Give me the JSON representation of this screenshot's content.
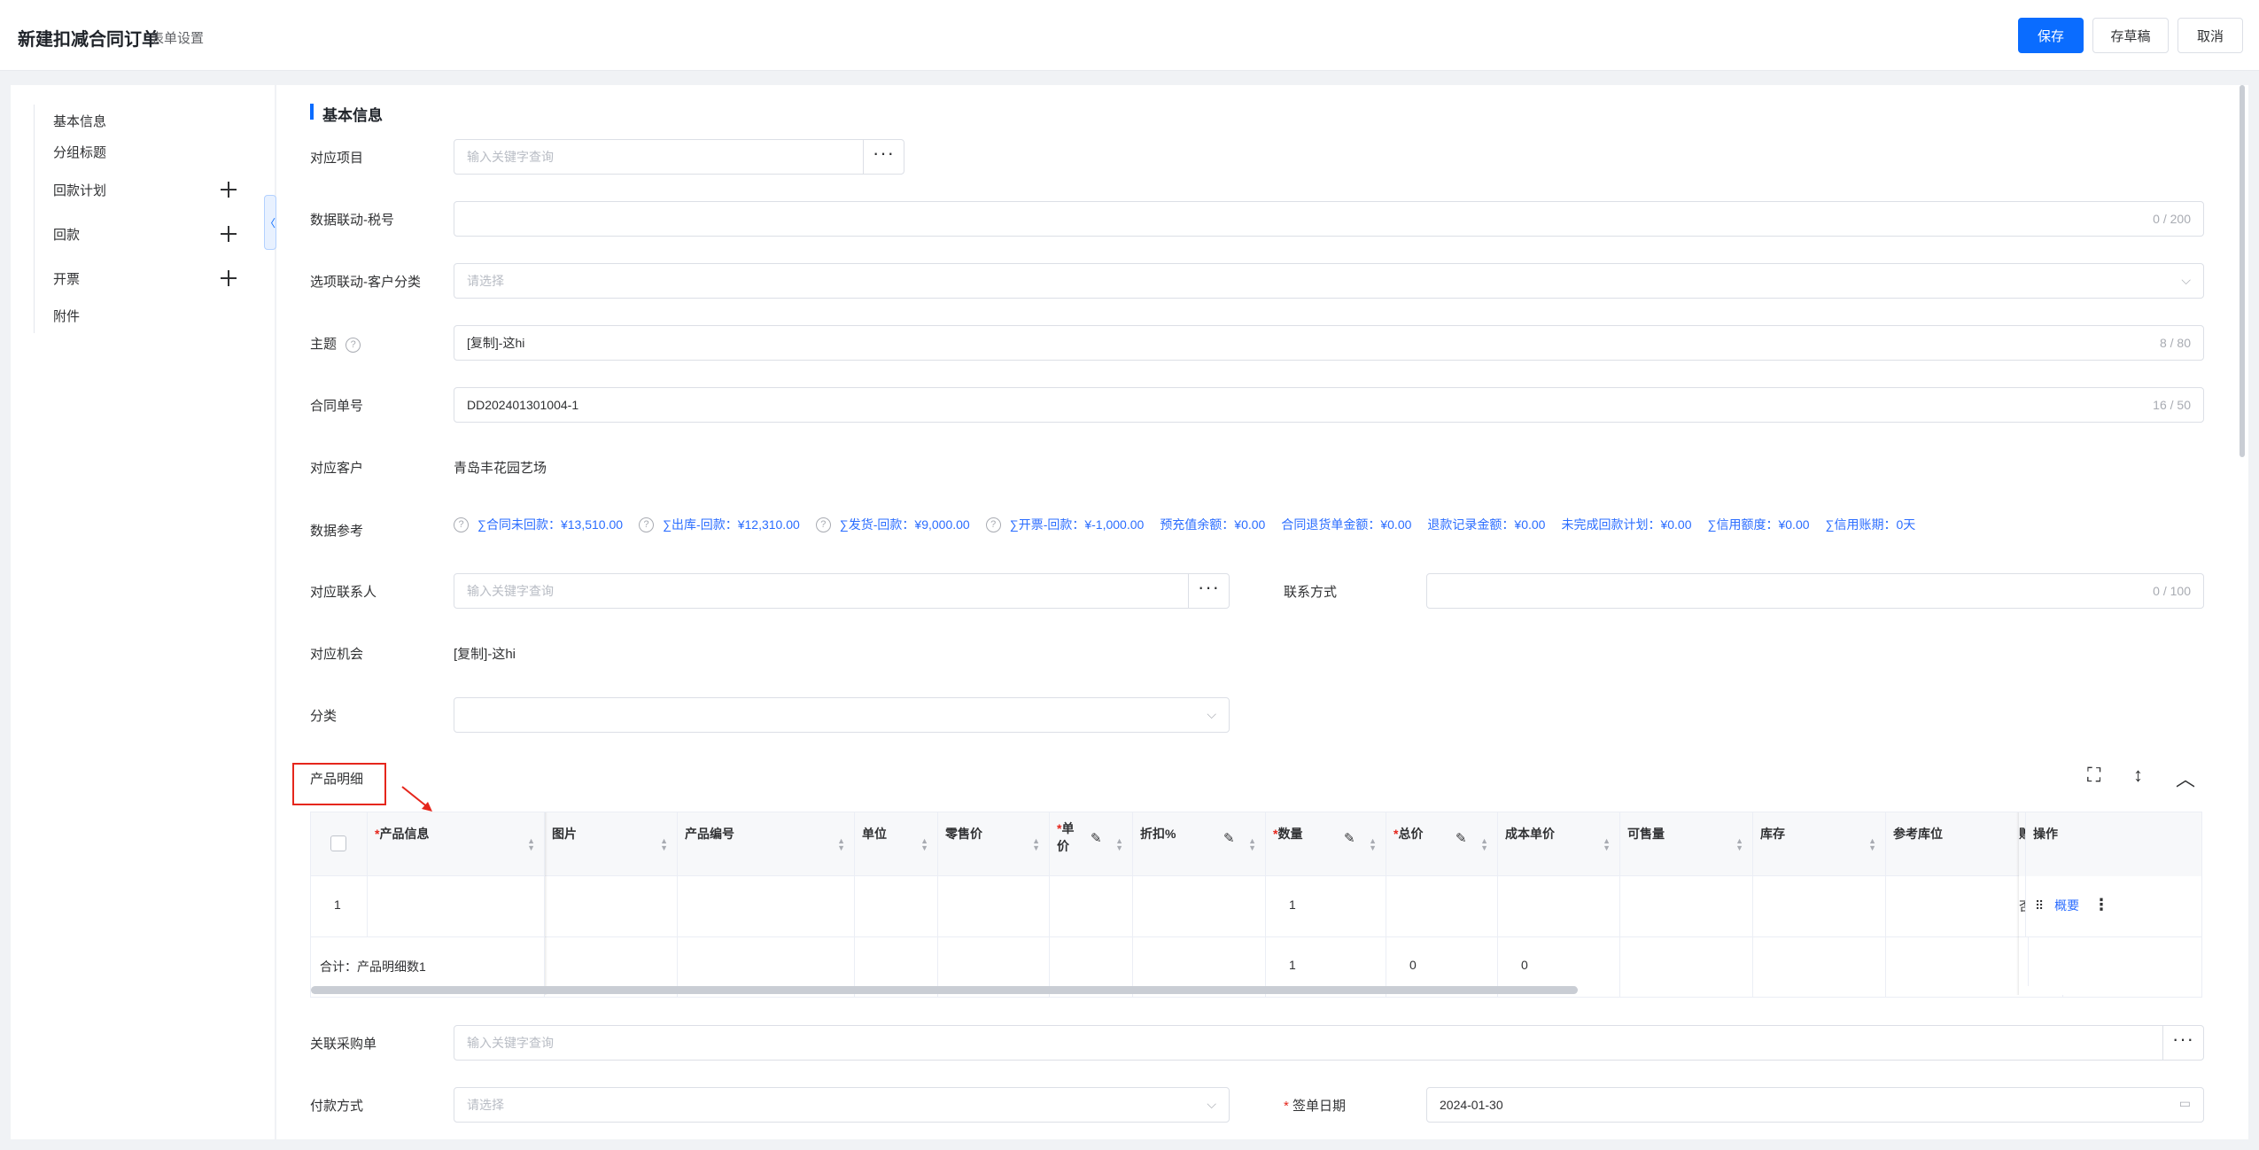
{
  "header": {
    "title": "新建扣减合同订单",
    "form_setting": "表单设置",
    "save": "保存",
    "draft": "存草稿",
    "cancel": "取消"
  },
  "sidebar": {
    "items": [
      "基本信息",
      "分组标题",
      "回款计划",
      "回款",
      "开票",
      "附件"
    ],
    "collapse_glyph": "〈"
  },
  "section": {
    "title": "基本信息"
  },
  "form": {
    "project": {
      "label": "对应项目",
      "placeholder": "输入关键字查询"
    },
    "tax": {
      "label": "数据联动-税号",
      "counter": "0 / 200"
    },
    "customer_type": {
      "label": "选项联动-客户分类",
      "placeholder": "请选择"
    },
    "subject": {
      "label": "主题",
      "value": "[复制]-这hi",
      "counter": "8 / 80"
    },
    "contract_no": {
      "label": "合同单号",
      "value": "DD202401301004-1",
      "counter": "16 / 50"
    },
    "customer": {
      "label": "对应客户",
      "value": "青岛丰花园艺场"
    },
    "data_ref": {
      "label": "数据参考"
    },
    "contact": {
      "label": "对应联系人",
      "placeholder": "输入关键字查询"
    },
    "contact_method": {
      "label": "联系方式",
      "counter": "0 / 100"
    },
    "opportunity": {
      "label": "对应机会",
      "value": "[复制]-这hi"
    },
    "category": {
      "label": "分类"
    },
    "purchase": {
      "label": "关联采购单",
      "placeholder": "输入关键字查询"
    },
    "payment": {
      "label": "付款方式",
      "placeholder": "请选择"
    },
    "sign_date": {
      "label": "签单日期",
      "required_mark": "*",
      "value": "2024-01-30"
    }
  },
  "refs": [
    "∑合同未回款：¥13,510.00",
    "∑出库-回款：¥12,310.00",
    "∑发货-回款：¥9,000.00",
    "∑开票-回款：¥-1,000.00",
    "预充值余额：¥0.00",
    "合同退货单金额：¥0.00",
    "退款记录金额：¥0.00",
    "未完成回款计划：¥0.00",
    "∑信用额度：¥0.00",
    "∑信用账期：0天"
  ],
  "help_glyph": "?",
  "dots_glyph": "···",
  "chevron_glyph": "⌵",
  "calendar_glyph": "▭",
  "product": {
    "title": "产品明细",
    "tools": [
      "⛶",
      "↕",
      "︿"
    ],
    "columns": {
      "product_info": "产品信息",
      "image": "图片",
      "code": "产品编号",
      "unit": "单位",
      "retail": "零售价",
      "price_1": "单",
      "price_2": "价",
      "discount": "折扣%",
      "qty": "数量",
      "total": "总价",
      "cost": "成本单价",
      "sellable": "可售量",
      "stock": "库存",
      "location": "参考库位",
      "gift": "赠品",
      "ops": "操作"
    },
    "required_mark": "*",
    "edit_glyph": "✎",
    "sort_up": "▲",
    "sort_down": "▼",
    "row": {
      "index": "1",
      "qty": "1",
      "gift": "否",
      "drag": "⠿",
      "overview": "概要",
      "more": "⋮"
    },
    "summary": {
      "label": "合计：产品明细数1",
      "qty": "1",
      "total": "0",
      "cost": "0"
    }
  }
}
